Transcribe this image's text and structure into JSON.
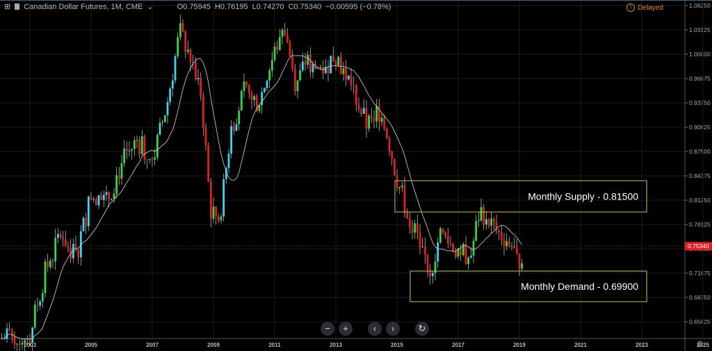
{
  "header": {
    "symbol": "Canadian Dollar Futures, 1M, CME",
    "open": "O0.75945",
    "high": "H0.76195",
    "low": "L0.74270",
    "close": "C0.75340",
    "change": "−0.00595 (−0.78%)"
  },
  "status": {
    "delayed": "Delayed"
  },
  "nav": {
    "zoom_out": "−",
    "zoom_in": "+",
    "left": "‹",
    "right": "›",
    "reset": "↻"
  },
  "colors": {
    "up": "#36d64a",
    "down": "#e0201e",
    "up_alt": "#3dd4ee",
    "ma": "#d8d8d8",
    "box": "#c8cc3a",
    "last": "#e0201e"
  },
  "chart_data": {
    "type": "candlestick",
    "title": "Canadian Dollar Futures, 1M, CME",
    "ylim": [
      0.64,
      1.0745
    ],
    "xlim": [
      2002.0,
      2026.3
    ],
    "y_ticks": [
      "1.06250",
      "1.03125",
      "1.00000",
      "0.96875",
      "0.93750",
      "0.90625",
      "0.87500",
      "0.84375",
      "0.81250",
      "0.78125",
      "0.75000",
      "0.71875",
      "0.68750",
      "0.65625"
    ],
    "x_ticks": [
      "2003",
      "2005",
      "2007",
      "2009",
      "2011",
      "2013",
      "2015",
      "2017",
      "2019",
      "2021",
      "2023",
      "2025"
    ],
    "last_price": "0.75340",
    "moving_average_period": 12,
    "close_anchors": [
      [
        2002.0,
        0.635
      ],
      [
        2003.0,
        0.64
      ],
      [
        2003.5,
        0.72
      ],
      [
        2004.0,
        0.77
      ],
      [
        2004.5,
        0.74
      ],
      [
        2005.0,
        0.82
      ],
      [
        2005.5,
        0.81
      ],
      [
        2006.0,
        0.86
      ],
      [
        2006.5,
        0.89
      ],
      [
        2007.0,
        0.86
      ],
      [
        2007.5,
        0.94
      ],
      [
        2007.9,
        1.03
      ],
      [
        2008.3,
        0.99
      ],
      [
        2008.6,
        0.95
      ],
      [
        2008.9,
        0.8
      ],
      [
        2009.2,
        0.79
      ],
      [
        2009.6,
        0.91
      ],
      [
        2010.0,
        0.95
      ],
      [
        2010.5,
        0.94
      ],
      [
        2010.9,
        0.99
      ],
      [
        2011.3,
        1.04
      ],
      [
        2011.7,
        0.96
      ],
      [
        2012.0,
        0.99
      ],
      [
        2012.5,
        0.98
      ],
      [
        2013.0,
        1.0
      ],
      [
        2013.5,
        0.96
      ],
      [
        2014.0,
        0.91
      ],
      [
        2014.5,
        0.93
      ],
      [
        2015.0,
        0.84
      ],
      [
        2015.3,
        0.8
      ],
      [
        2015.9,
        0.74
      ],
      [
        2016.1,
        0.72
      ],
      [
        2016.4,
        0.77
      ],
      [
        2016.9,
        0.75
      ],
      [
        2017.4,
        0.74
      ],
      [
        2017.7,
        0.8
      ],
      [
        2018.0,
        0.79
      ],
      [
        2018.3,
        0.77
      ],
      [
        2018.7,
        0.76
      ],
      [
        2018.95,
        0.73
      ],
      [
        2019.15,
        0.7534
      ]
    ],
    "zones": [
      {
        "label": "Monthly Supply - 0.81500",
        "from": 2014.93,
        "to": 2023.16,
        "top": 0.8375,
        "bottom": 0.7973
      },
      {
        "label": "Monthly Demand - 0.69900",
        "from": 2015.43,
        "to": 2023.16,
        "top": 0.7214,
        "bottom": 0.6821
      }
    ]
  }
}
